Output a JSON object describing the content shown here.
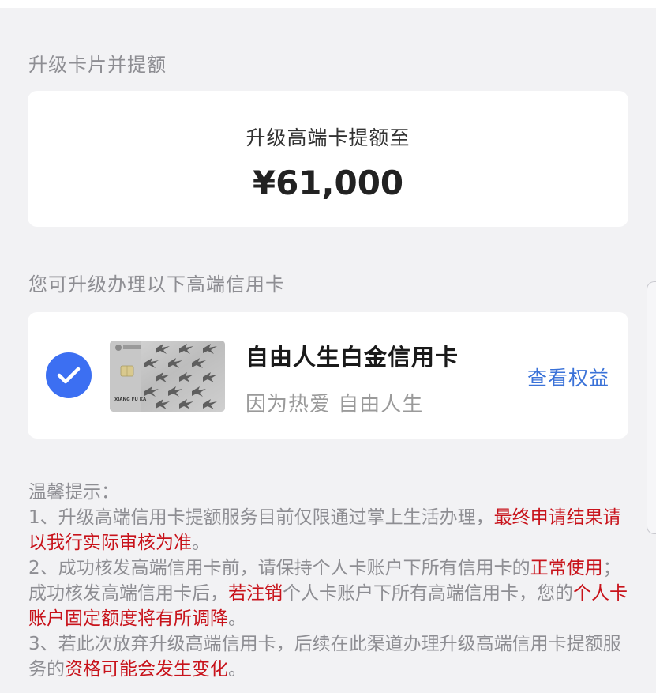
{
  "section_upgrade_title": "升级卡片并提额",
  "limit_card": {
    "label": "升级高端卡提额至",
    "amount": "¥61,000"
  },
  "section_cards_title": "您可升级办理以下高端信用卡",
  "upgrade_card": {
    "name": "自由人生白金信用卡",
    "slogan": "因为热爱 自由人生",
    "benefits_link": "查看权益",
    "selected": true,
    "card_image_text": "XIANG FU KA"
  },
  "tips": {
    "heading": "温馨提示：",
    "items": [
      [
        {
          "text": "1、升级高端信用卡提额服务目前仅限通过掌上生活办理，",
          "hl": false
        },
        {
          "text": "最终申请结果请以我行实际审核为准",
          "hl": true
        },
        {
          "text": "。",
          "hl": false
        }
      ],
      [
        {
          "text": "2、成功核发高端信用卡前，请保持个人卡账户下所有信用卡的",
          "hl": false
        },
        {
          "text": "正常使用",
          "hl": true
        },
        {
          "text": "；成功核发高端信用卡后，",
          "hl": false
        },
        {
          "text": "若注销",
          "hl": true
        },
        {
          "text": "个人卡账户下所有高端信用卡，您的",
          "hl": false
        },
        {
          "text": "个人卡账户固定额度将有所调降",
          "hl": true
        },
        {
          "text": "。",
          "hl": false
        }
      ],
      [
        {
          "text": "3、若此次放弃升级高端信用卡，后续在此渠道办理升级高端信用卡提额服务的",
          "hl": false
        },
        {
          "text": "资格可能会发生变化",
          "hl": true
        },
        {
          "text": "。",
          "hl": false
        }
      ]
    ]
  },
  "colors": {
    "page_background": "#f2f2f4",
    "accent_blue": "#3c6ff2",
    "link_blue": "#3a72d8",
    "highlight_red": "#c8131b",
    "muted_text": "#8e8e93"
  },
  "icons": {
    "selected_indicator": "checkmark-circle-icon"
  }
}
